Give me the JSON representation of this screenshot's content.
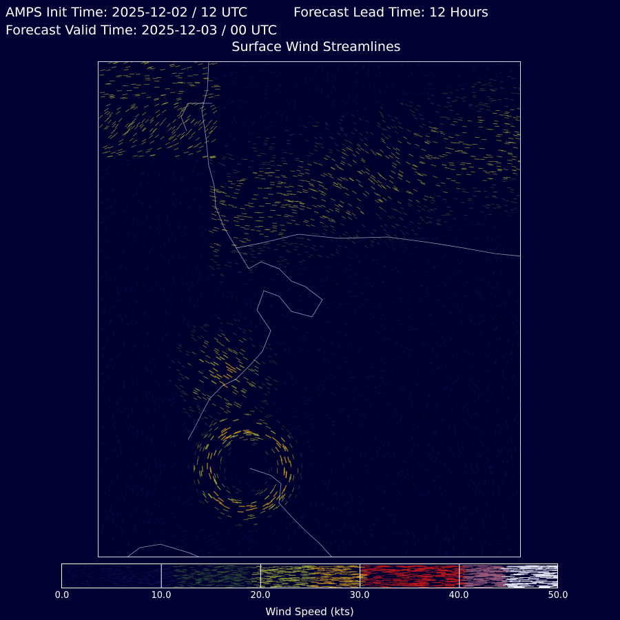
{
  "header": {
    "init_time": "AMPS Init Time: 2025-12-02 / 12 UTC",
    "lead_time": "Forecast Lead Time: 12 Hours",
    "valid_time": "Forecast Valid Time: 2025-12-03 / 00 UTC",
    "title": "Surface Wind Streamlines"
  },
  "map": {
    "background_color": "#000033",
    "coastline_color": "#c8c8d8",
    "border_color": "#d8d8e8"
  },
  "colorbar": {
    "label": "Wind Speed (kts)",
    "range": [
      0.0,
      50.0
    ],
    "ticks": [
      "0.0",
      "10.0",
      "20.0",
      "30.0",
      "40.0",
      "50.0"
    ],
    "colors": {
      "calm": "#141a5a",
      "light": "#3c6a3a",
      "moderate": "#b8c23a",
      "fresh": "#d8a020",
      "strong": "#c81a1a",
      "gale": "#a06080",
      "storm": "#e8e8f8"
    }
  }
}
